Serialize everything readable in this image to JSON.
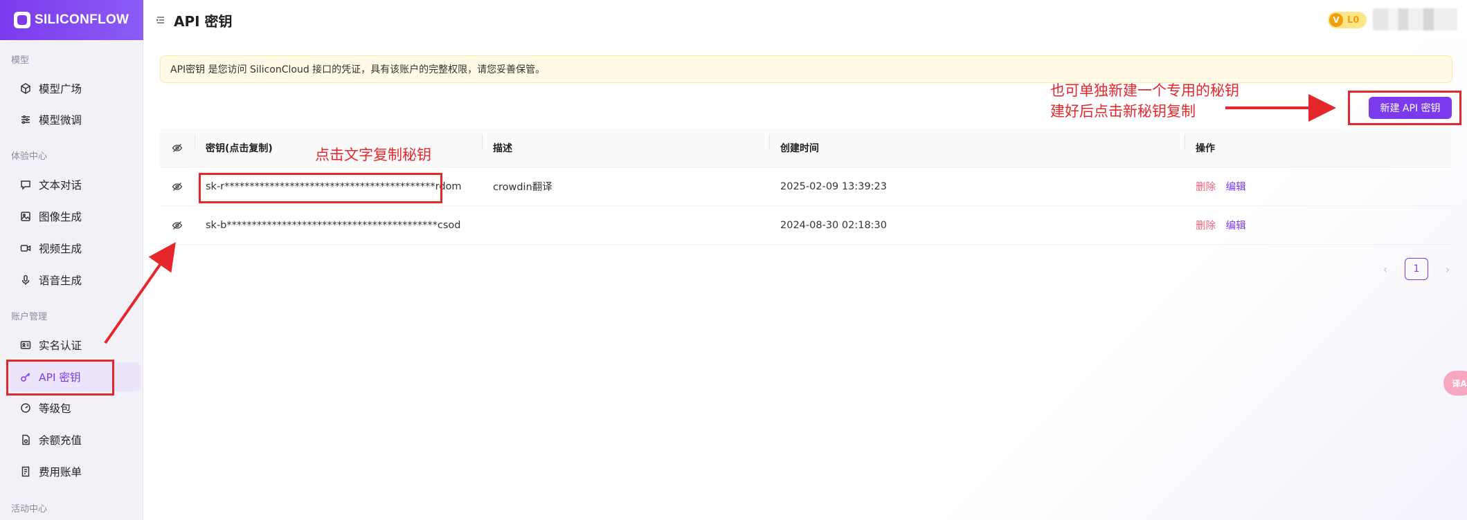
{
  "brand": {
    "name": "SILICONFLOW"
  },
  "sidebar": {
    "sections": [
      {
        "label": "模型"
      },
      {
        "label": "体验中心"
      },
      {
        "label": "账户管理"
      },
      {
        "label": "活动中心"
      }
    ],
    "items": [
      {
        "label": "模型广场",
        "icon": "cube-icon"
      },
      {
        "label": "模型微调",
        "icon": "sliders-icon"
      },
      {
        "label": "文本对话",
        "icon": "chat-icon"
      },
      {
        "label": "图像生成",
        "icon": "image-icon"
      },
      {
        "label": "视频生成",
        "icon": "video-icon"
      },
      {
        "label": "语音生成",
        "icon": "microphone-icon"
      },
      {
        "label": "实名认证",
        "icon": "id-card-icon"
      },
      {
        "label": "API 密钥",
        "icon": "key-icon",
        "active": true
      },
      {
        "label": "等级包",
        "icon": "gauge-icon"
      },
      {
        "label": "余额充值",
        "icon": "wallet-icon"
      },
      {
        "label": "费用账单",
        "icon": "bill-icon"
      }
    ]
  },
  "header": {
    "title": "API 密钥",
    "level": "L0"
  },
  "notice": "API密钥 是您访问 SiliconCloud 接口的凭证，具有该账户的完整权限，请您妥善保管。",
  "new_key_button": "新建 API 密钥",
  "table": {
    "columns": [
      "密钥(点击复制)",
      "描述",
      "创建时间",
      "操作"
    ],
    "rows": [
      {
        "key": "sk-r******************************************rdom",
        "desc": "crowdin翻译",
        "created": "2025-02-09 13:39:23",
        "delete": "删除",
        "edit": "编辑"
      },
      {
        "key": "sk-b******************************************csod",
        "desc": "",
        "created": "2024-08-30 02:18:30",
        "delete": "删除",
        "edit": "编辑"
      }
    ]
  },
  "pagination": {
    "current": "1",
    "prev": "‹",
    "next": "›"
  },
  "float_button": "译A",
  "annotations": {
    "click_copy": "点击文字复制秘钥",
    "new_key_line1": "也可单独新建一个专用的秘钥",
    "new_key_line2": "建好后点击新秘钥复制"
  },
  "colors": {
    "accent": "#7c3aed",
    "annotation": "#e5262b",
    "danger": "#f5627c"
  }
}
